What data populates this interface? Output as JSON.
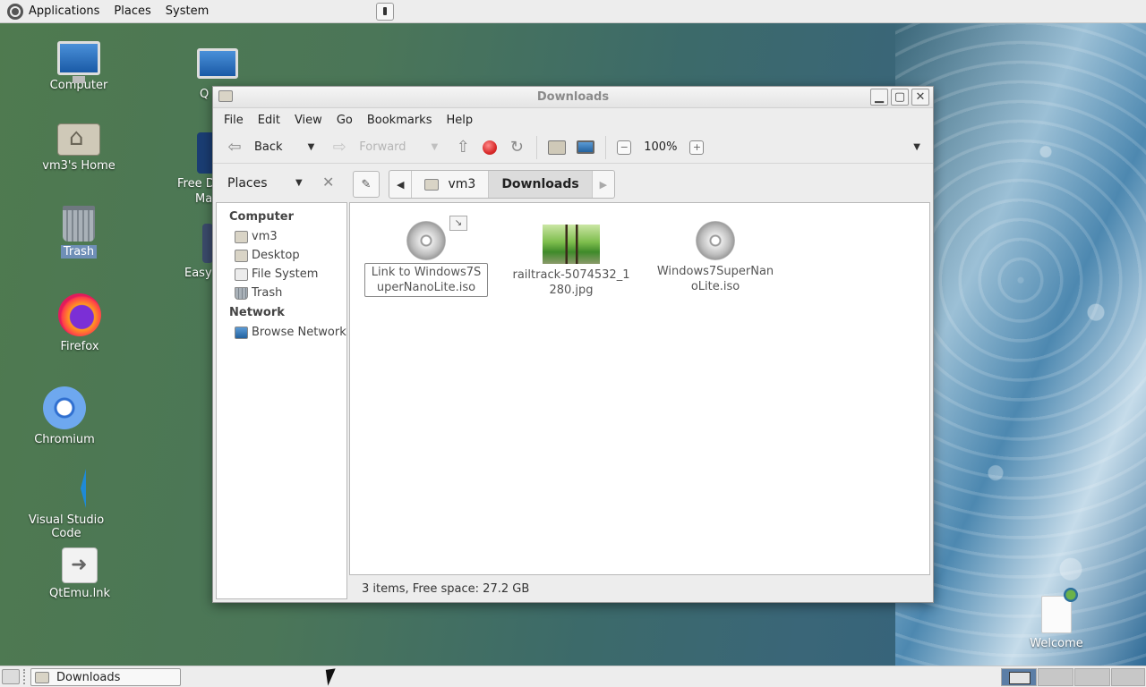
{
  "top_panel": {
    "menus": [
      "Applications",
      "Places",
      "System"
    ]
  },
  "desktop": {
    "icons": [
      {
        "label": "Computer",
        "icon": "computer-icon"
      },
      {
        "label": "vm3's Home",
        "icon": "home-folder-icon"
      },
      {
        "label": "Trash",
        "icon": "trash-icon",
        "selected": true
      },
      {
        "label": "Firefox",
        "icon": "firefox-icon"
      },
      {
        "label": "Chromium",
        "icon": "chromium-icon"
      },
      {
        "label": "Visual Studio Code",
        "icon": "vscode-icon"
      },
      {
        "label": "QtEmu.lnk",
        "icon": "qtemu-icon"
      },
      {
        "label": "Welcome",
        "icon": "welcome-icon"
      }
    ],
    "partial_labels": [
      "Q",
      "Free D",
      "Ma",
      "Easy"
    ]
  },
  "window": {
    "title": "Downloads",
    "menubar": [
      "File",
      "Edit",
      "View",
      "Go",
      "Bookmarks",
      "Help"
    ],
    "toolbar": {
      "back_label": "Back",
      "forward_label": "Forward",
      "zoom_level": "100%"
    },
    "places_header": "Places",
    "location": {
      "crumbs": [
        "vm3",
        "Downloads"
      ]
    },
    "sidebar": {
      "sections": [
        {
          "title": "Computer",
          "items": [
            "vm3",
            "Desktop",
            "File System",
            "Trash"
          ]
        },
        {
          "title": "Network",
          "items": [
            "Browse Network"
          ]
        }
      ]
    },
    "files": [
      {
        "name": "Link to Windows7SuperNanoLite.iso",
        "icon": "disc-icon",
        "link": true,
        "selected": true
      },
      {
        "name": "railtrack-5074532_1280.jpg",
        "icon": "image-thumbnail"
      },
      {
        "name": "Windows7SuperNanoLite.iso",
        "icon": "disc-icon"
      }
    ],
    "status": "3 items, Free space: 27.2 GB"
  },
  "taskbar": {
    "task_label": "Downloads"
  }
}
